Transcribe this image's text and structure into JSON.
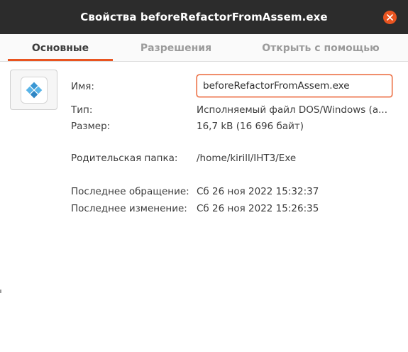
{
  "window": {
    "title": "Свойства beforeRefactorFromAssem.exe",
    "accent_color": "#e95420",
    "titlebar_color": "#2c2c2c"
  },
  "tabs": [
    {
      "label": "Основные",
      "active": true
    },
    {
      "label": "Разрешения",
      "active": false
    },
    {
      "label": "Открыть с помощью",
      "active": false
    }
  ],
  "file": {
    "icon": "executable-diamond-icon",
    "name_label": "Имя:",
    "name_value": "beforeRefactorFromAssem.exe",
    "type_label": "Тип:",
    "type_value": "Исполняемый файл DOS/Windows (a...",
    "size_label": "Размер:",
    "size_value": "16,7 kB (16 696 байт)",
    "parent_label": "Родительская папка:",
    "parent_value": "/home/kirill/IHT3/Exe",
    "accessed_label": "Последнее обращение:",
    "accessed_value": "Сб 26 ноя 2022 15:32:37",
    "modified_label": "Последнее изменение:",
    "modified_value": "Сб 26 ноя 2022 15:26:35"
  }
}
